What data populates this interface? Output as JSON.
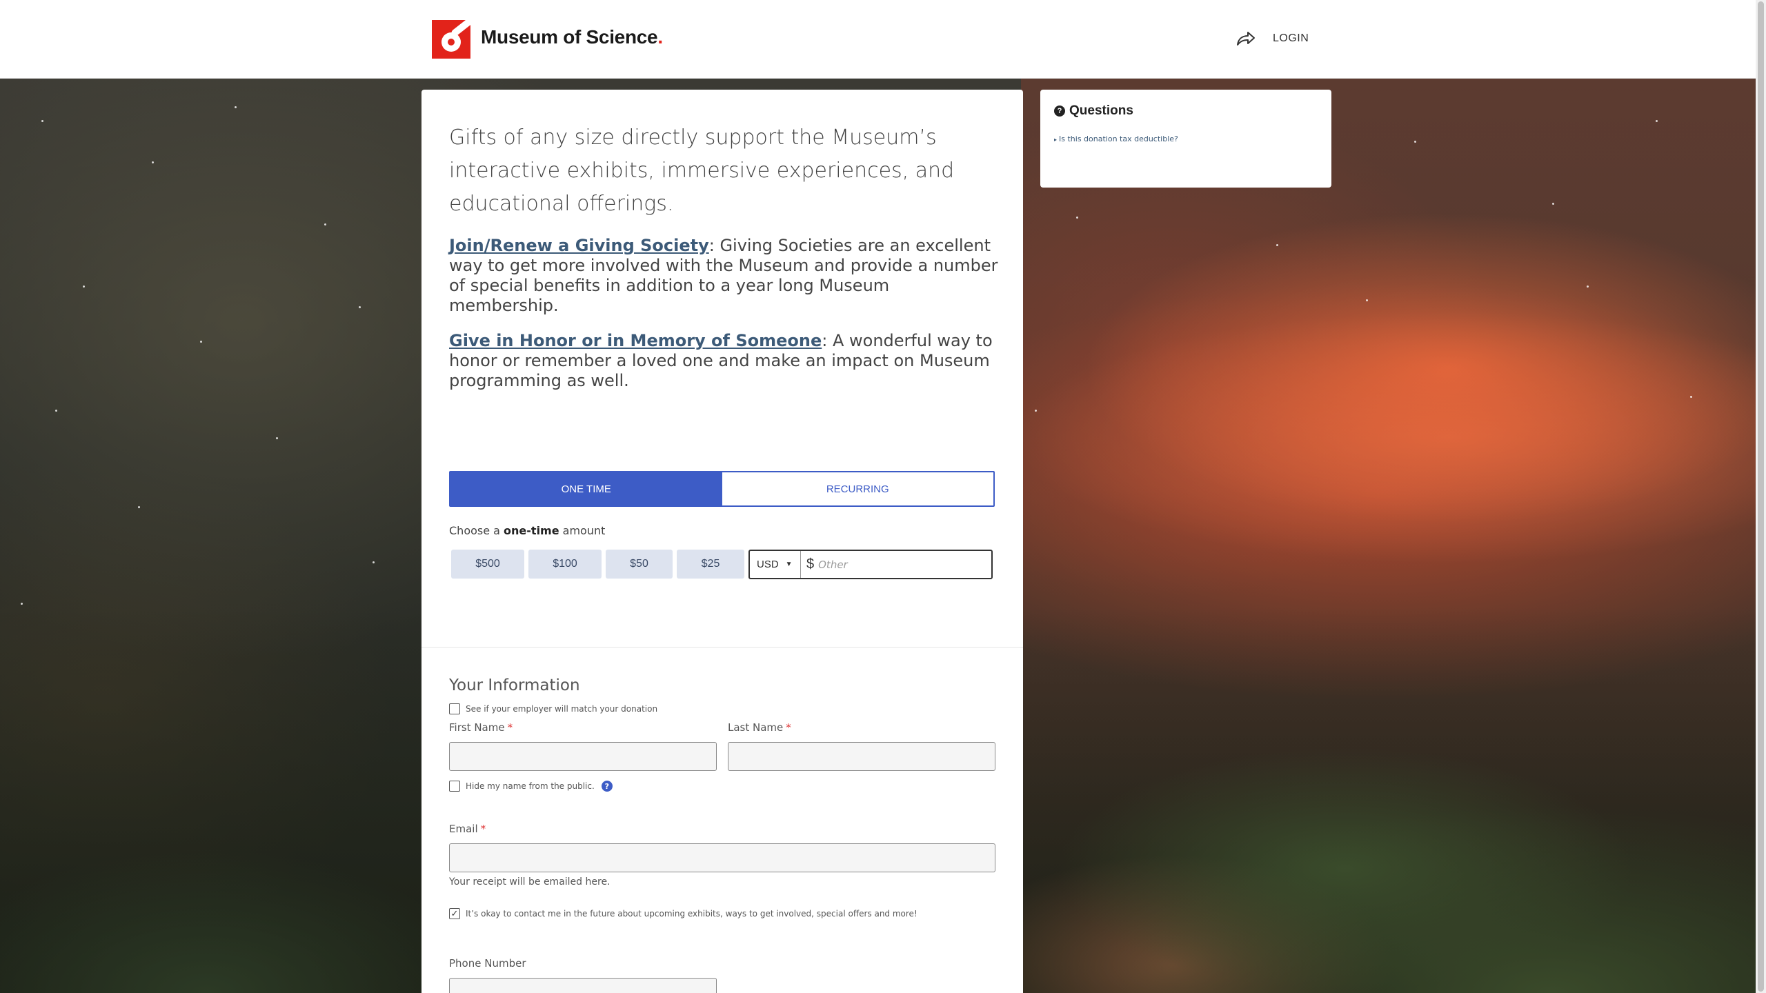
{
  "header": {
    "brand": "Museum of Science",
    "brand_dot": ".",
    "login_label": "LOGIN"
  },
  "intro": {
    "text": "Gifts of any size directly support the Museum’s interactive exhibits, immersive experiences, and educational offerings."
  },
  "giving_society": {
    "link_text": "Join/Renew a Giving Society",
    "text": ": Giving Societies are an excellent way to get more involved with the Museum and provide a number of special benefits in addition to a year long Museum membership."
  },
  "honor": {
    "link_text": "Give in Honor or in Memory of Someone",
    "text": ":  A wonderful way to honor or remember a loved one and make an impact on Museum programming as well."
  },
  "frequency": {
    "one_time_label": "ONE TIME",
    "recurring_label": "RECURRING",
    "selected": "ONE TIME"
  },
  "amount": {
    "choose_prefix": "Choose a ",
    "choose_bold": "one-time",
    "choose_suffix": " amount",
    "options": [
      "$500",
      "$100",
      "$50",
      "$25"
    ],
    "currency": "USD",
    "currency_symbol": "$",
    "other_placeholder": "Other",
    "employer_match_label": "See if your employer will match your donation"
  },
  "your_information": {
    "title": "Your Information",
    "first_name_label": "First Name",
    "last_name_label": "Last Name",
    "required_mark": "*",
    "hide_name_label": "Hide my name from the public.",
    "email_label": "Email",
    "email_hint": "Your receipt will be emailed here.",
    "contact_consent_label": "It’s okay to contact me in the future about upcoming exhibits, ways to get involved, special offers and more!",
    "contact_consent_checked": true,
    "phone_label": "Phone Number"
  },
  "questions": {
    "title": "Questions",
    "items": [
      "Is this donation tax deductible?"
    ]
  },
  "colors": {
    "accent_blue": "#3d5cc6",
    "brand_red": "#e2231a",
    "link_color": "#3c5a78"
  }
}
